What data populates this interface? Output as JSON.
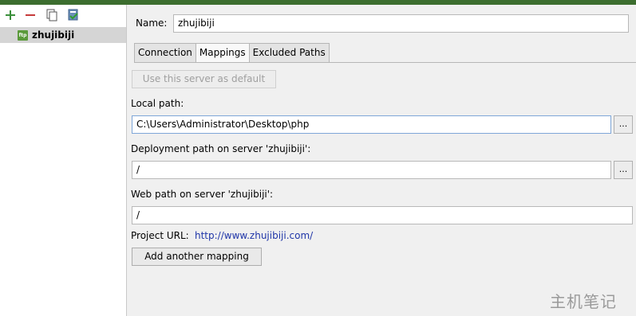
{
  "left_panel": {
    "toolbar": [
      {
        "icon": "add-icon"
      },
      {
        "icon": "remove-icon"
      },
      {
        "icon": "copy-icon"
      },
      {
        "icon": "use-as-default-icon"
      }
    ],
    "servers": [
      {
        "icon": "ftp-icon",
        "icon_text": "ftp",
        "name": "zhujibiji"
      }
    ]
  },
  "form": {
    "name_label": "Name:",
    "name_value": "zhujibiji",
    "tabs": [
      "Connection",
      "Mappings",
      "Excluded Paths"
    ],
    "active_tab": "Mappings",
    "use_default_label": "Use this server as default",
    "local_path_label": "Local path:",
    "local_path_value": "C:\\Users\\Administrator\\Desktop\\php",
    "deployment_path_label": "Deployment path on server 'zhujibiji':",
    "deployment_path_value": "/",
    "web_path_label": "Web path on server 'zhujibiji':",
    "web_path_value": "/",
    "browse_label": "...",
    "project_url_label": "Project URL:",
    "project_url_value": "http://www.zhujibiji.com/",
    "add_mapping_label": "Add another mapping"
  },
  "watermark": "主机笔记",
  "colors": {
    "title_bar": "#3c6e2f",
    "link": "#1f35a8",
    "selection": "#d5d5d5"
  }
}
